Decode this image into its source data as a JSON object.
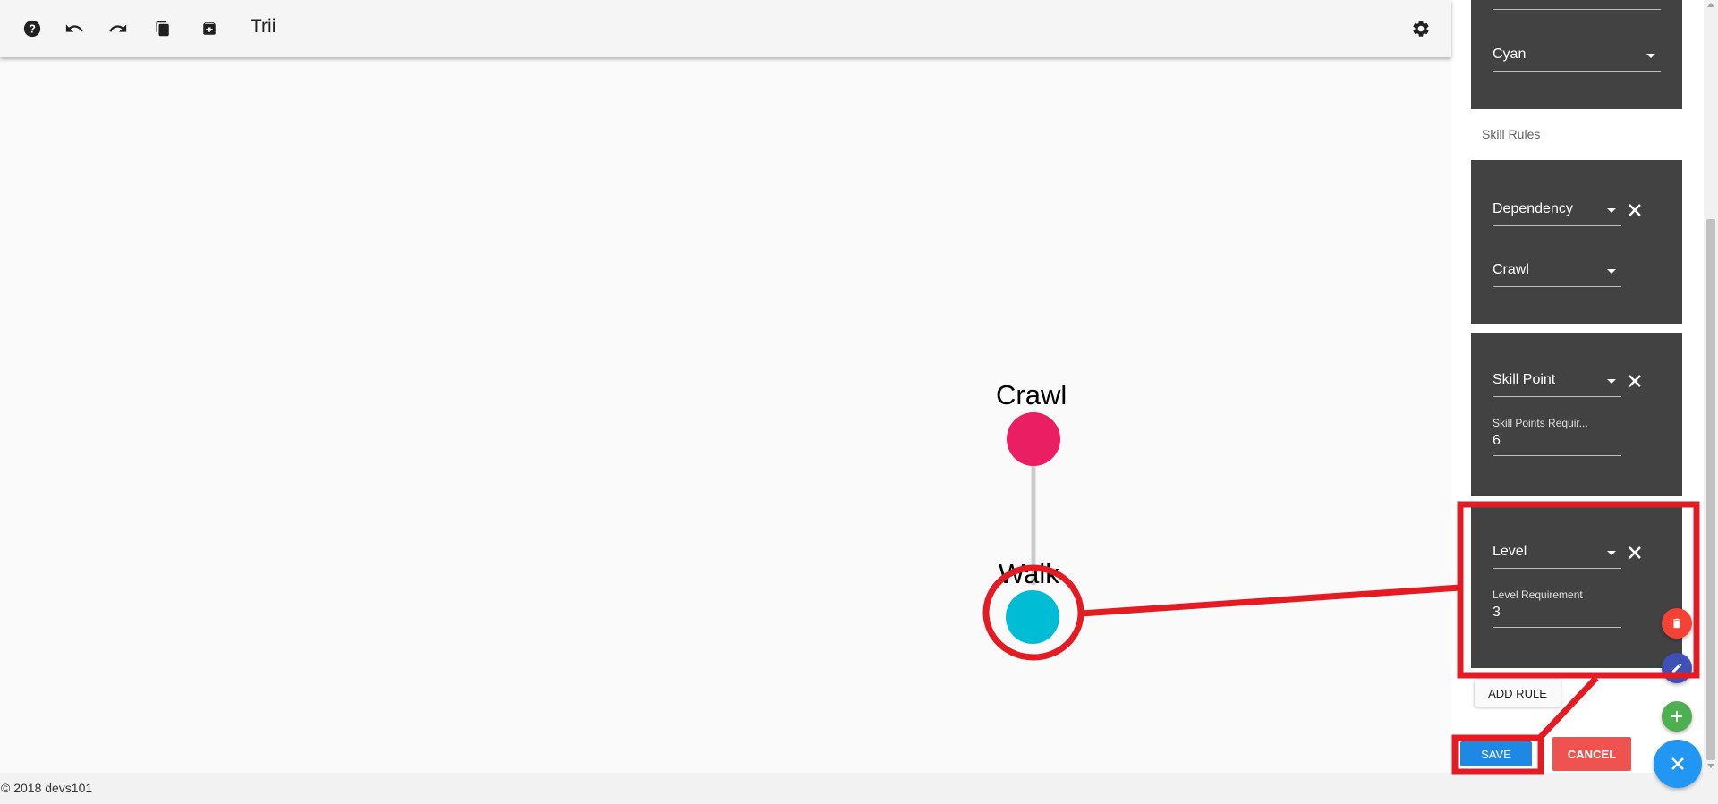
{
  "toolbar": {
    "title": "Trii",
    "icons": [
      "help-icon",
      "undo-icon",
      "redo-icon",
      "copy-icon",
      "archive-icon",
      "gear-icon"
    ]
  },
  "graph": {
    "nodes": [
      {
        "name": "Crawl",
        "color": "#e91e63"
      },
      {
        "name": "Walk",
        "color": "#00bcd4"
      }
    ],
    "edge_color": "#cccccc"
  },
  "footer": {
    "copyright": "© 2018 devs101"
  },
  "panel": {
    "color_select": {
      "value": "Cyan"
    },
    "skill_rules_label": "Skill Rules",
    "rules": [
      {
        "type": "Dependency",
        "value": "Crawl"
      },
      {
        "type": "Skill Point",
        "field_label": "Skill Points Requir...",
        "field_value": "6"
      },
      {
        "type": "Level",
        "field_label": "Level Requirement",
        "field_value": "3"
      }
    ],
    "add_rule_label": "ADD RULE",
    "save_label": "SAVE",
    "cancel_label": "CANCEL"
  },
  "fabs": {
    "delete_color": "#f44336",
    "edit_color": "#3f51b5",
    "add_color": "#4caf50",
    "close_color": "#2196f3"
  },
  "annotation_color": "#e31b23"
}
